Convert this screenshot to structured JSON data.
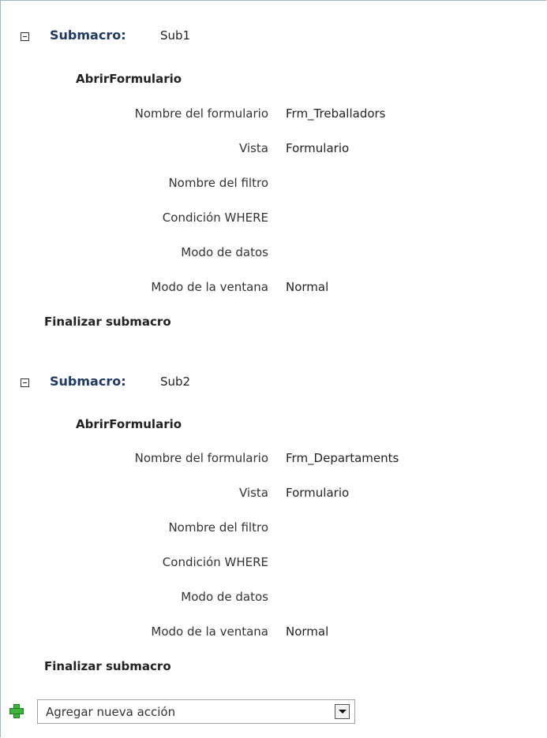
{
  "submacros": [
    {
      "keyword": "Submacro:",
      "name": "Sub1",
      "action": "AbrirFormulario",
      "args": [
        {
          "label": "Nombre del formulario",
          "value": "Frm_Treballadors"
        },
        {
          "label": "Vista",
          "value": "Formulario"
        },
        {
          "label": "Nombre del filtro",
          "value": ""
        },
        {
          "label": "Condición WHERE",
          "value": ""
        },
        {
          "label": "Modo de datos",
          "value": ""
        },
        {
          "label": "Modo de la ventana",
          "value": "Normal"
        }
      ],
      "end_label": "Finalizar submacro"
    },
    {
      "keyword": "Submacro:",
      "name": "Sub2",
      "action": "AbrirFormulario",
      "args": [
        {
          "label": "Nombre del formulario",
          "value": "Frm_Departaments"
        },
        {
          "label": "Vista",
          "value": "Formulario"
        },
        {
          "label": "Nombre del filtro",
          "value": ""
        },
        {
          "label": "Condición WHERE",
          "value": ""
        },
        {
          "label": "Modo de datos",
          "value": ""
        },
        {
          "label": "Modo de la ventana",
          "value": "Normal"
        }
      ],
      "end_label": "Finalizar submacro"
    }
  ],
  "add_action": {
    "placeholder": "Agregar nueva acción",
    "icon": "plus-icon",
    "dropdown_icon": "chevron-down-icon"
  }
}
